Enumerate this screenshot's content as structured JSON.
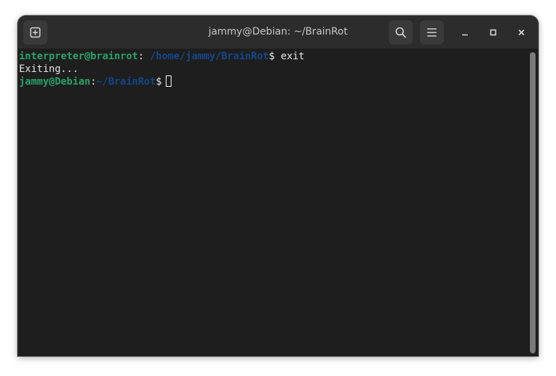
{
  "window": {
    "title": "jammy@Debian: ~/BrainRot"
  },
  "headerbar": {
    "new_tab_icon": "new-tab-icon",
    "search_icon": "search-icon",
    "menu_icon": "hamburger-menu-icon",
    "minimize_icon": "minimize-icon",
    "maximize_icon": "maximize-icon",
    "close_icon": "close-icon"
  },
  "terminal": {
    "lines": [
      {
        "user_host": "interpreter@brainrot",
        "separator": ":",
        "path": " /home/jammy/BrainRot",
        "prompt_symbol": "$",
        "command": " exit"
      },
      {
        "output": "Exiting..."
      },
      {
        "user_host": "jammy@Debian",
        "separator": ":",
        "path": "~/BrainRot",
        "prompt_symbol": "$",
        "command": ""
      }
    ]
  },
  "colors": {
    "background": "#1e1e1e",
    "headerbar": "#2c2c2c",
    "prompt_green": "#26a269",
    "path_blue": "#12488b",
    "text": "#e6e6e6"
  }
}
